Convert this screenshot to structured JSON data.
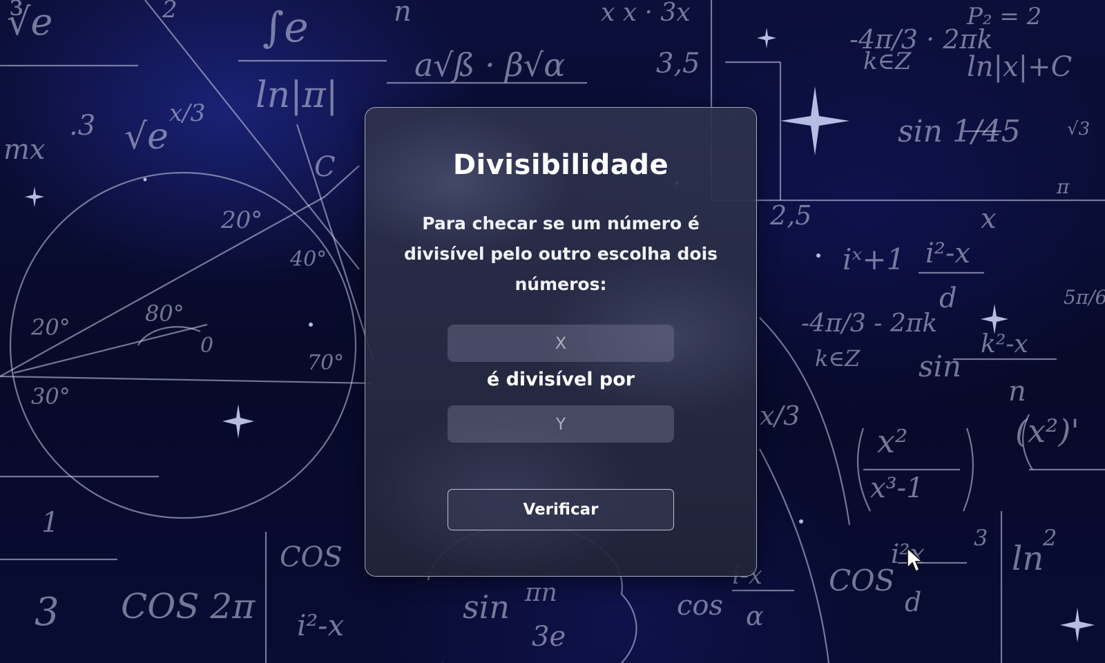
{
  "page": {
    "background_theme": "math-chalkboard-starfield",
    "colors": {
      "background": "#070a2a",
      "card": "#2e324e",
      "text": "#ffffff",
      "input": "#6e708f"
    }
  },
  "card": {
    "title": "Divisibilidade",
    "description": "Para checar se um número é divisível pelo outro escolha dois números:",
    "input_x": {
      "placeholder": "X",
      "value": ""
    },
    "between_label": "é divisível por",
    "input_y": {
      "placeholder": "Y",
      "value": ""
    },
    "verify_button_label": "Verificar"
  },
  "cursor": {
    "icon": "arrow-pointer-icon"
  }
}
